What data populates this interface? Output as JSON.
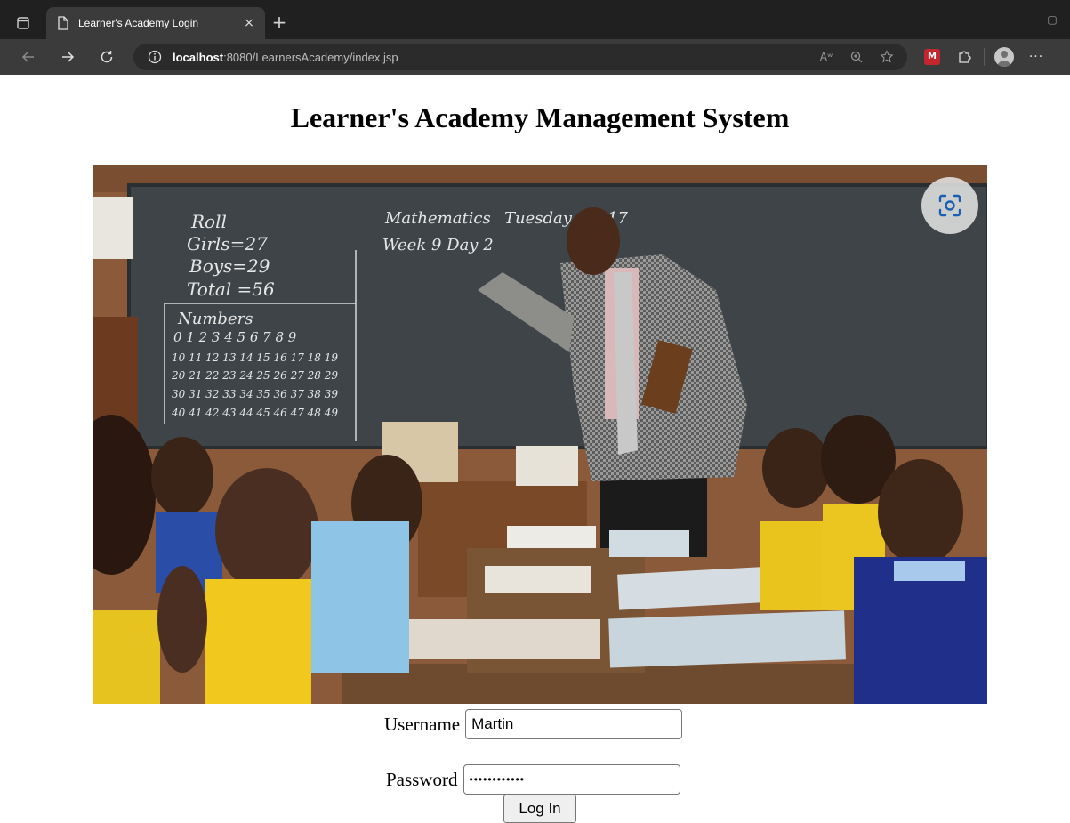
{
  "browser": {
    "tab_title": "Learner's Academy Login",
    "tab_close": "×",
    "new_tab": "+",
    "url_host": "localhost",
    "url_rest": ":8080/LearnersAcademy/index.jsp",
    "ext_label": "M",
    "menu": "···",
    "read_aloud": "Aʷ"
  },
  "page": {
    "title": "Learner's Academy Management System",
    "username_label": "Username",
    "username_value": "Martin",
    "password_label": "Password",
    "password_value": "••••••••••••",
    "login_button": "Log In"
  },
  "chalkboard": {
    "roll": "Roll",
    "girls": "Girls=27",
    "boys": "Boys=29",
    "total": "Total =56",
    "subject": "Mathematics",
    "week": "Week 9  Day 2",
    "day": "Tuesday  4.4.17",
    "numbers": "Numbers",
    "row1": "0  1  2  3  4  5  6  7  8  9",
    "row2": "10 11 12 13 14 15 16 17 18 19",
    "row3": "20 21 22 23 24 25 26 27 28 29",
    "row4": "30 31 32 33 34 35 36 37 38 39",
    "row5": "40 41 42 43 44 45 46 47 48 49"
  }
}
